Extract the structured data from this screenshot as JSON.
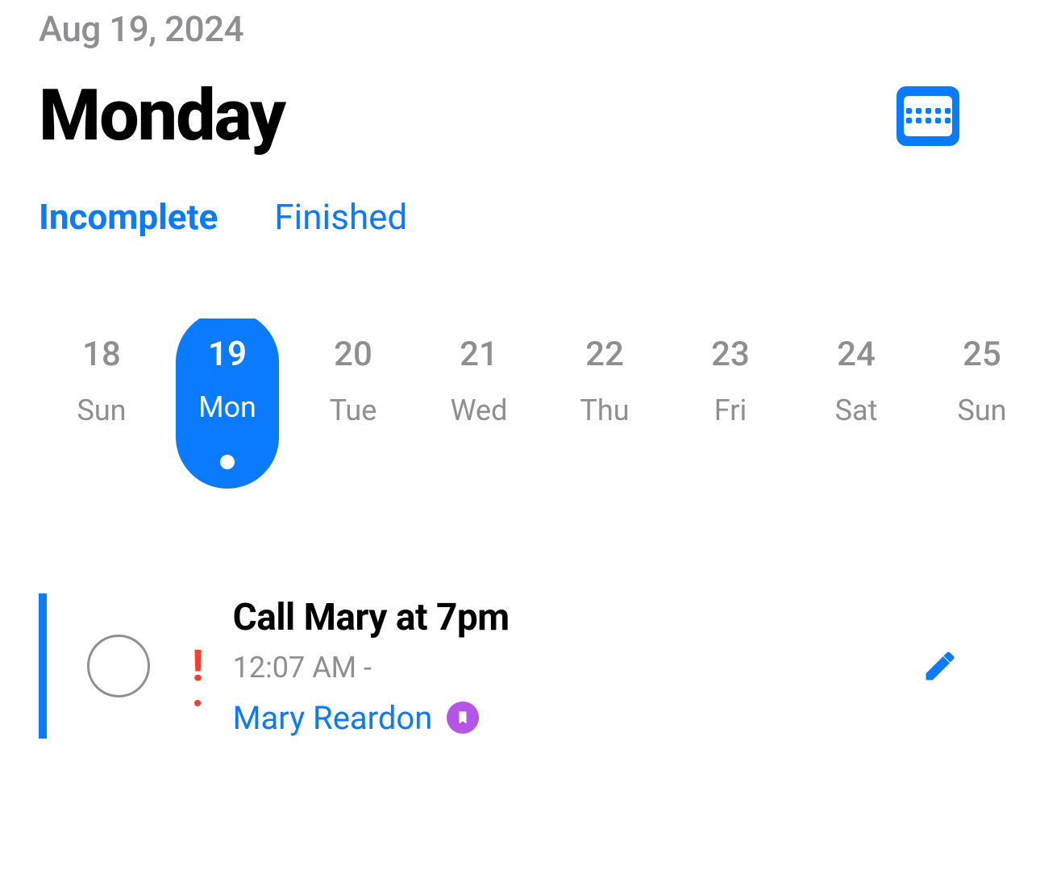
{
  "header": {
    "date_label": "Aug 19, 2024",
    "day_name": "Monday"
  },
  "tabs": {
    "incomplete_label": "Incomplete",
    "finished_label": "Finished",
    "active": "incomplete"
  },
  "week": {
    "days": [
      {
        "num": "18",
        "dow": "Sun",
        "selected": false
      },
      {
        "num": "19",
        "dow": "Mon",
        "selected": true
      },
      {
        "num": "20",
        "dow": "Tue",
        "selected": false
      },
      {
        "num": "21",
        "dow": "Wed",
        "selected": false
      },
      {
        "num": "22",
        "dow": "Thu",
        "selected": false
      },
      {
        "num": "23",
        "dow": "Fri",
        "selected": false
      },
      {
        "num": "24",
        "dow": "Sat",
        "selected": false
      },
      {
        "num": "25",
        "dow": "Sun",
        "selected": false
      }
    ]
  },
  "task": {
    "title": "Call Mary at 7pm",
    "time": "12:07 AM",
    "separator": " -",
    "contact": "Mary Reardon"
  }
}
